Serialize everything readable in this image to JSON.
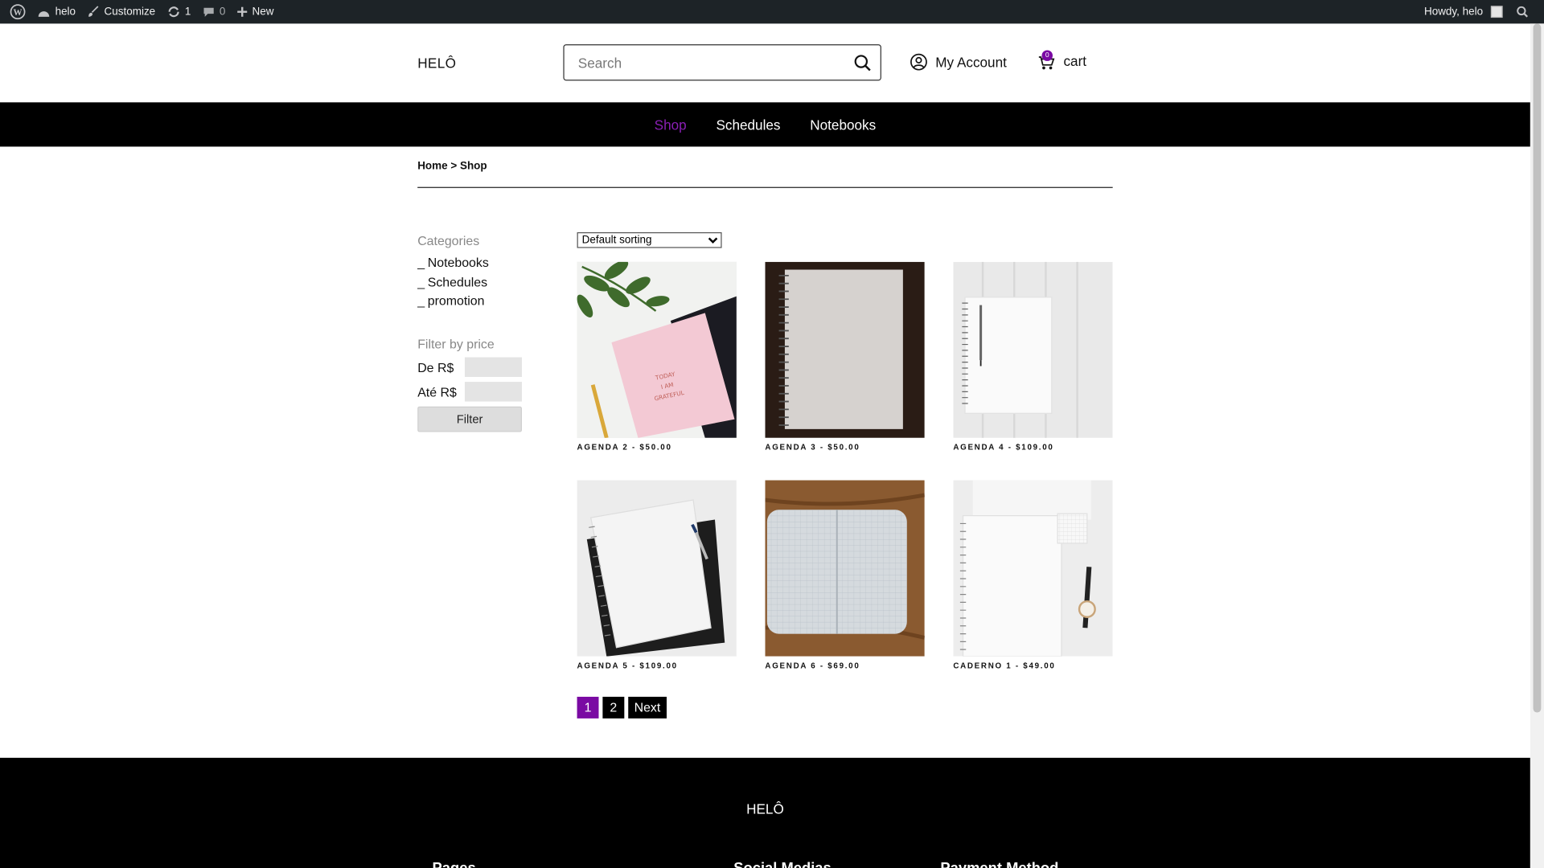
{
  "admin_bar": {
    "site_name": "helo",
    "customize": "Customize",
    "updates_count": "1",
    "comments_count": "0",
    "new_label": "New",
    "howdy": "Howdy, helo"
  },
  "header": {
    "logo": "HELÔ",
    "search_placeholder": "Search",
    "account_label": "My Account",
    "cart_label": "cart",
    "cart_count": "0"
  },
  "nav": {
    "items": [
      {
        "label": "Shop",
        "active": true
      },
      {
        "label": "Schedules",
        "active": false
      },
      {
        "label": "Notebooks",
        "active": false
      }
    ]
  },
  "breadcrumb": "Home > Shop",
  "sidebar": {
    "categories_title": "Categories",
    "categories": [
      "Notebooks",
      "Schedules",
      "promotion"
    ],
    "price_title": "Filter by price",
    "from_label": "De R$",
    "to_label": "Até R$",
    "filter_button": "Filter"
  },
  "sorting": {
    "selected": "Default sorting"
  },
  "products": [
    {
      "title": "AGENDA 2 - $50.00"
    },
    {
      "title": "AGENDA 3 - $50.00"
    },
    {
      "title": "AGENDA 4 - $109.00"
    },
    {
      "title": "AGENDA 5 - $109.00"
    },
    {
      "title": "AGENDA 6 - $69.00"
    },
    {
      "title": "CADERNO 1 - $49.00"
    }
  ],
  "pagination": {
    "pages": [
      "1",
      "2"
    ],
    "current": "1",
    "next": "Next"
  },
  "footer": {
    "logo": "HELÔ",
    "columns": [
      "Pages",
      "Social Medias",
      "Payment Method"
    ]
  },
  "colors": {
    "accent": "#7a0aa3",
    "admin_bar": "#1d2327",
    "nav_bg": "#000000"
  }
}
